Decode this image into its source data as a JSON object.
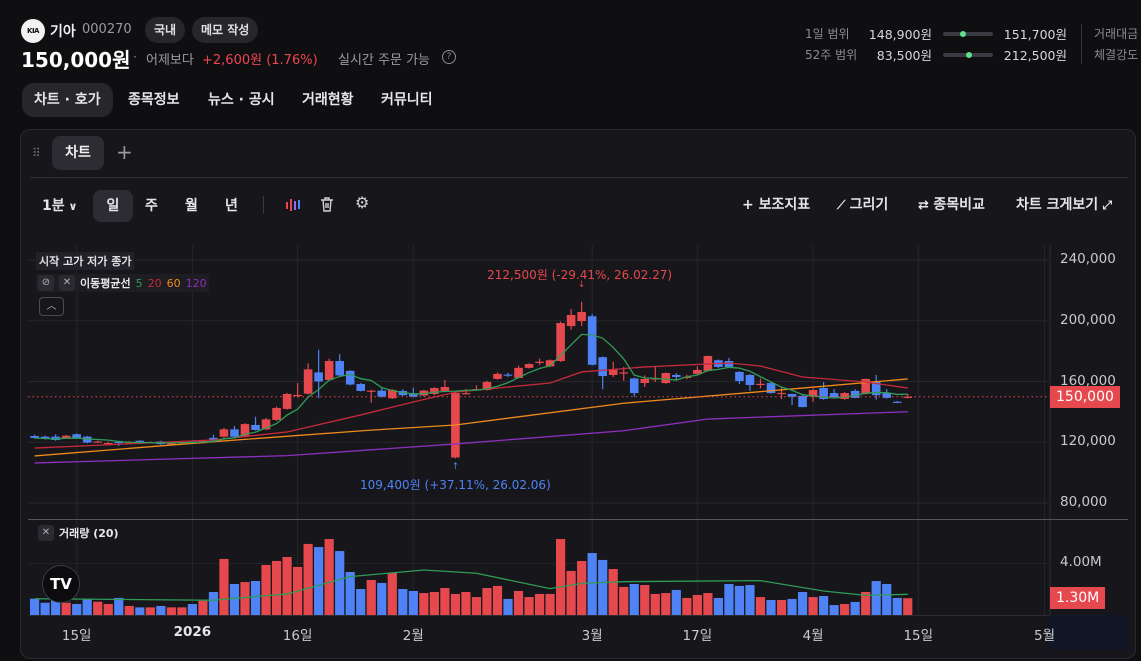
{
  "header": {
    "logo_text": "KIA",
    "name": "기아",
    "code": "000270",
    "chip_market": "국내",
    "chip_memo": "메모 작성",
    "price": "150,000원",
    "separator": "·",
    "prev_label": "어제보다",
    "change": "+2,600원 (1.76%)",
    "realtime": "실시간 주문 가능",
    "help_icon": "?"
  },
  "nav": {
    "tabs": [
      "차트 · 호가",
      "종목정보",
      "뉴스 · 공시",
      "거래현황",
      "커뮤니티"
    ],
    "active": 0
  },
  "ranges": [
    {
      "label": "1일 범위",
      "low": "148,900원",
      "high": "151,700원",
      "position": 0.39
    },
    {
      "label": "52주 범위",
      "low": "83,500원",
      "high": "212,500원",
      "position": 0.52
    }
  ],
  "side_labels": [
    "거래대금",
    "체결강도"
  ],
  "chart_panel": {
    "tab": "차트",
    "add": "+"
  },
  "toolbar": {
    "interval": "1분",
    "periods": [
      "일",
      "주",
      "월",
      "년"
    ],
    "active_period": "일",
    "add_indicator": "+ 보조지표",
    "draw": "그리기",
    "compare": "종목비교",
    "fullscreen": "차트 크게보기"
  },
  "legend": {
    "ohlc": "시작 고가 저가 종가",
    "ma_label": "이동평균선",
    "ma_periods": [
      "5",
      "20",
      "60",
      "120"
    ],
    "volume_label": "거래량 (20)"
  },
  "colors": {
    "up": "#e5484d",
    "down": "#4e82f5",
    "ma5": "#2f9c57",
    "ma20": "#c42a3c",
    "ma60": "#f08a1c",
    "ma120": "#8e2fc0",
    "vol_ma": "#2f9c57"
  },
  "chart_data": {
    "type": "candlestick",
    "price_unit": "KRW thousands",
    "volume_unit": "M shares",
    "ylim": [
      70,
      250
    ],
    "y_ticks": [
      {
        "v": 240,
        "label": "240,000"
      },
      {
        "v": 200,
        "label": "200,000"
      },
      {
        "v": 160,
        "label": "160,000"
      },
      {
        "v": 120,
        "label": "120,000"
      },
      {
        "v": 80,
        "label": "80,000"
      }
    ],
    "volume_ticks": [
      {
        "v": 4,
        "label": "4.00M"
      }
    ],
    "x_ticks": [
      {
        "i": 4,
        "label": "15일"
      },
      {
        "i": 15,
        "label": "2026"
      },
      {
        "i": 25,
        "label": "16일"
      },
      {
        "i": 36,
        "label": "2월"
      },
      {
        "i": 53,
        "label": "3월"
      },
      {
        "i": 63,
        "label": "17일"
      },
      {
        "i": 74,
        "label": "4월"
      },
      {
        "i": 84,
        "label": "15일"
      },
      {
        "i": 96,
        "label": "5월"
      }
    ],
    "last_price": {
      "v": 150,
      "label": "150,000"
    },
    "last_volume": {
      "v": 1.3,
      "label": "1.30M"
    },
    "annotations": [
      {
        "i": 52,
        "v": 212.5,
        "text": "212,500원 (-29.41%, 26.02.27)",
        "kind": "high"
      },
      {
        "i": 40,
        "v": 109.4,
        "text": "109,400원 (+37.11%, 26.02.06)",
        "kind": "low"
      }
    ],
    "candles": [
      [
        124.1,
        125.0,
        122.5,
        122.8,
        1.26
      ],
      [
        123.7,
        124.3,
        121.8,
        122.2,
        0.95
      ],
      [
        123.7,
        125.3,
        121.0,
        121.5,
        1.21
      ],
      [
        122.8,
        124.8,
        122.3,
        124.3,
        0.95
      ],
      [
        125.3,
        125.8,
        122.6,
        123.0,
        0.85
      ],
      [
        123.7,
        124.2,
        119.3,
        119.8,
        1.24
      ],
      [
        120.2,
        121.0,
        119.8,
        120.5,
        1.03
      ],
      [
        119.2,
        120.3,
        118.8,
        119.5,
        0.85
      ],
      [
        120.2,
        120.6,
        117.5,
        119.9,
        1.32
      ],
      [
        119.8,
        120.8,
        119.4,
        120.1,
        0.7
      ],
      [
        121.0,
        121.4,
        119.0,
        119.4,
        0.59
      ],
      [
        119.6,
        120.6,
        119.2,
        120.0,
        0.59
      ],
      [
        120.5,
        121.0,
        118.4,
        118.8,
        0.7
      ],
      [
        118.6,
        120.3,
        117.8,
        119.8,
        0.59
      ],
      [
        120.0,
        121.0,
        119.7,
        120.4,
        0.59
      ],
      [
        120.4,
        121.2,
        119.8,
        120.2,
        0.85
      ],
      [
        119.4,
        121.6,
        119.2,
        121.3,
        1.11
      ],
      [
        122.9,
        125.0,
        120.8,
        121.0,
        1.78
      ],
      [
        123.7,
        129.5,
        122.0,
        128.5,
        4.34
      ],
      [
        128.5,
        130.7,
        123.2,
        123.7,
        2.4
      ],
      [
        123.7,
        132.6,
        123.2,
        132.0,
        2.55
      ],
      [
        131.4,
        136.8,
        127.8,
        128.1,
        2.63
      ],
      [
        128.5,
        136.0,
        128.0,
        135.1,
        3.87
      ],
      [
        134.7,
        143.5,
        134.0,
        142.6,
        4.18
      ],
      [
        142.0,
        152.5,
        141.5,
        151.8,
        4.49
      ],
      [
        150.8,
        159.0,
        149.5,
        151.2,
        3.72
      ],
      [
        152.0,
        172.0,
        151.5,
        168.0,
        5.5
      ],
      [
        166.0,
        181.0,
        149.0,
        160.0,
        5.26
      ],
      [
        161.0,
        175.0,
        160.5,
        173.5,
        5.88
      ],
      [
        173.5,
        178.0,
        163.5,
        164.0,
        4.95
      ],
      [
        167.0,
        167.5,
        157.5,
        158.0,
        3.33
      ],
      [
        158.4,
        159.0,
        153.5,
        153.8,
        2.01
      ],
      [
        153.6,
        154.5,
        146.0,
        154.0,
        2.71
      ],
      [
        154.0,
        156.0,
        149.5,
        150.0,
        2.48
      ],
      [
        149.0,
        155.0,
        148.5,
        154.5,
        3.25
      ],
      [
        153.8,
        155.0,
        150.5,
        151.0,
        2.01
      ],
      [
        152.0,
        156.0,
        149.5,
        150.0,
        1.86
      ],
      [
        150.8,
        154.5,
        150.3,
        154.0,
        1.7
      ],
      [
        151.8,
        156.2,
        151.0,
        155.7,
        1.78
      ],
      [
        153.8,
        161.0,
        153.5,
        156.4,
        2.09
      ],
      [
        110.0,
        152.8,
        109.4,
        152.4,
        1.63
      ],
      [
        152.0,
        155.0,
        151.5,
        152.4,
        1.78
      ],
      [
        154.6,
        157.5,
        154.2,
        155.0,
        1.39
      ],
      [
        154.4,
        160.5,
        154.0,
        159.7,
        2.09
      ],
      [
        161.7,
        166.0,
        161.2,
        165.0,
        2.25
      ],
      [
        164.6,
        165.8,
        163.0,
        164.3,
        1.24
      ],
      [
        162.3,
        170.5,
        162.0,
        169.0,
        1.86
      ],
      [
        169.0,
        172.0,
        168.6,
        171.5,
        1.39
      ],
      [
        172.6,
        175.0,
        170.8,
        173.0,
        1.63
      ],
      [
        170.0,
        174.5,
        169.5,
        174.0,
        1.63
      ],
      [
        173.5,
        199.5,
        173.0,
        198.5,
        5.88
      ],
      [
        196.5,
        207.7,
        194.0,
        203.8,
        3.41
      ],
      [
        199.8,
        212.5,
        196.5,
        205.8,
        4.18
      ],
      [
        203.0,
        204.5,
        170.5,
        171.0,
        4.8
      ],
      [
        176.0,
        176.5,
        155.0,
        163.6,
        4.26
      ],
      [
        164.3,
        173.0,
        163.0,
        168.0,
        3.56
      ],
      [
        165.6,
        169.6,
        160.5,
        166.0,
        2.17
      ],
      [
        162.0,
        162.5,
        150.0,
        152.4,
        2.4
      ],
      [
        159.0,
        164.0,
        156.4,
        161.7,
        2.32
      ],
      [
        161.8,
        170.0,
        159.7,
        162.1,
        1.63
      ],
      [
        159.0,
        166.0,
        158.5,
        165.6,
        1.7
      ],
      [
        164.3,
        165.5,
        160.5,
        163.0,
        1.94
      ],
      [
        162.8,
        164.5,
        161.5,
        163.1,
        1.32
      ],
      [
        165.0,
        170.0,
        164.5,
        167.6,
        1.55
      ],
      [
        167.0,
        177.0,
        166.5,
        176.8,
        1.7
      ],
      [
        174.0,
        174.5,
        169.0,
        169.6,
        1.32
      ],
      [
        173.5,
        175.5,
        169.0,
        169.6,
        2.4
      ],
      [
        166.3,
        166.8,
        158.4,
        160.3,
        2.25
      ],
      [
        164.3,
        165.0,
        153.8,
        157.7,
        2.32
      ],
      [
        158.3,
        162.0,
        155.5,
        158.5,
        1.39
      ],
      [
        159.0,
        159.5,
        152.0,
        152.4,
        1.16
      ],
      [
        152.3,
        156.4,
        148.5,
        152.5,
        1.16
      ],
      [
        151.8,
        152.0,
        144.5,
        150.0,
        1.24
      ],
      [
        150.5,
        151.0,
        143.0,
        143.2,
        1.78
      ],
      [
        150.0,
        155.5,
        146.5,
        154.4,
        1.39
      ],
      [
        155.7,
        159.7,
        148.0,
        148.5,
        1.47
      ],
      [
        152.4,
        155.0,
        149.5,
        149.8,
        0.77
      ],
      [
        148.5,
        153.0,
        148.0,
        152.4,
        0.85
      ],
      [
        153.8,
        155.0,
        149.0,
        149.2,
        1.01
      ],
      [
        151.8,
        162.0,
        151.5,
        161.7,
        1.78
      ],
      [
        159.7,
        164.3,
        148.0,
        151.0,
        2.63
      ],
      [
        152.4,
        155.0,
        148.8,
        149.2,
        2.4
      ],
      [
        146.7,
        147.2,
        145.8,
        146.4,
        1.32
      ],
      [
        149.2,
        151.7,
        148.9,
        150.0,
        1.3
      ]
    ],
    "ma_keypoints": {
      "ma20": [
        [
          0,
          116.2
        ],
        [
          17,
          121.5
        ],
        [
          24,
          126.8
        ],
        [
          31,
          138
        ],
        [
          36,
          146.5
        ],
        [
          40,
          153
        ],
        [
          49,
          159
        ],
        [
          52,
          166.3
        ],
        [
          58,
          169.6
        ],
        [
          66,
          172.2
        ],
        [
          69,
          170.2
        ],
        [
          73,
          163
        ],
        [
          79,
          159.7
        ],
        [
          83,
          155.7
        ]
      ],
      "ma60": [
        [
          0,
          111
        ],
        [
          17,
          120.4
        ],
        [
          32,
          128
        ],
        [
          40,
          131.4
        ],
        [
          56,
          145.7
        ],
        [
          73,
          155.7
        ],
        [
          83,
          161.7
        ]
      ],
      "ma120": [
        [
          0,
          106.4
        ],
        [
          24,
          111.2
        ],
        [
          40,
          118.9
        ],
        [
          56,
          127.6
        ],
        [
          64,
          135.3
        ],
        [
          83,
          140.1
        ]
      ],
      "vol_ma20": [
        [
          0,
          1.26
        ],
        [
          17,
          1.14
        ],
        [
          24,
          1.63
        ],
        [
          30,
          2.97
        ],
        [
          37,
          3.48
        ],
        [
          42,
          3.23
        ],
        [
          49,
          2.04
        ],
        [
          52,
          2.45
        ],
        [
          56,
          2.58
        ],
        [
          69,
          2.66
        ],
        [
          75,
          1.86
        ],
        [
          79,
          1.52
        ],
        [
          83,
          1.6
        ]
      ]
    }
  }
}
